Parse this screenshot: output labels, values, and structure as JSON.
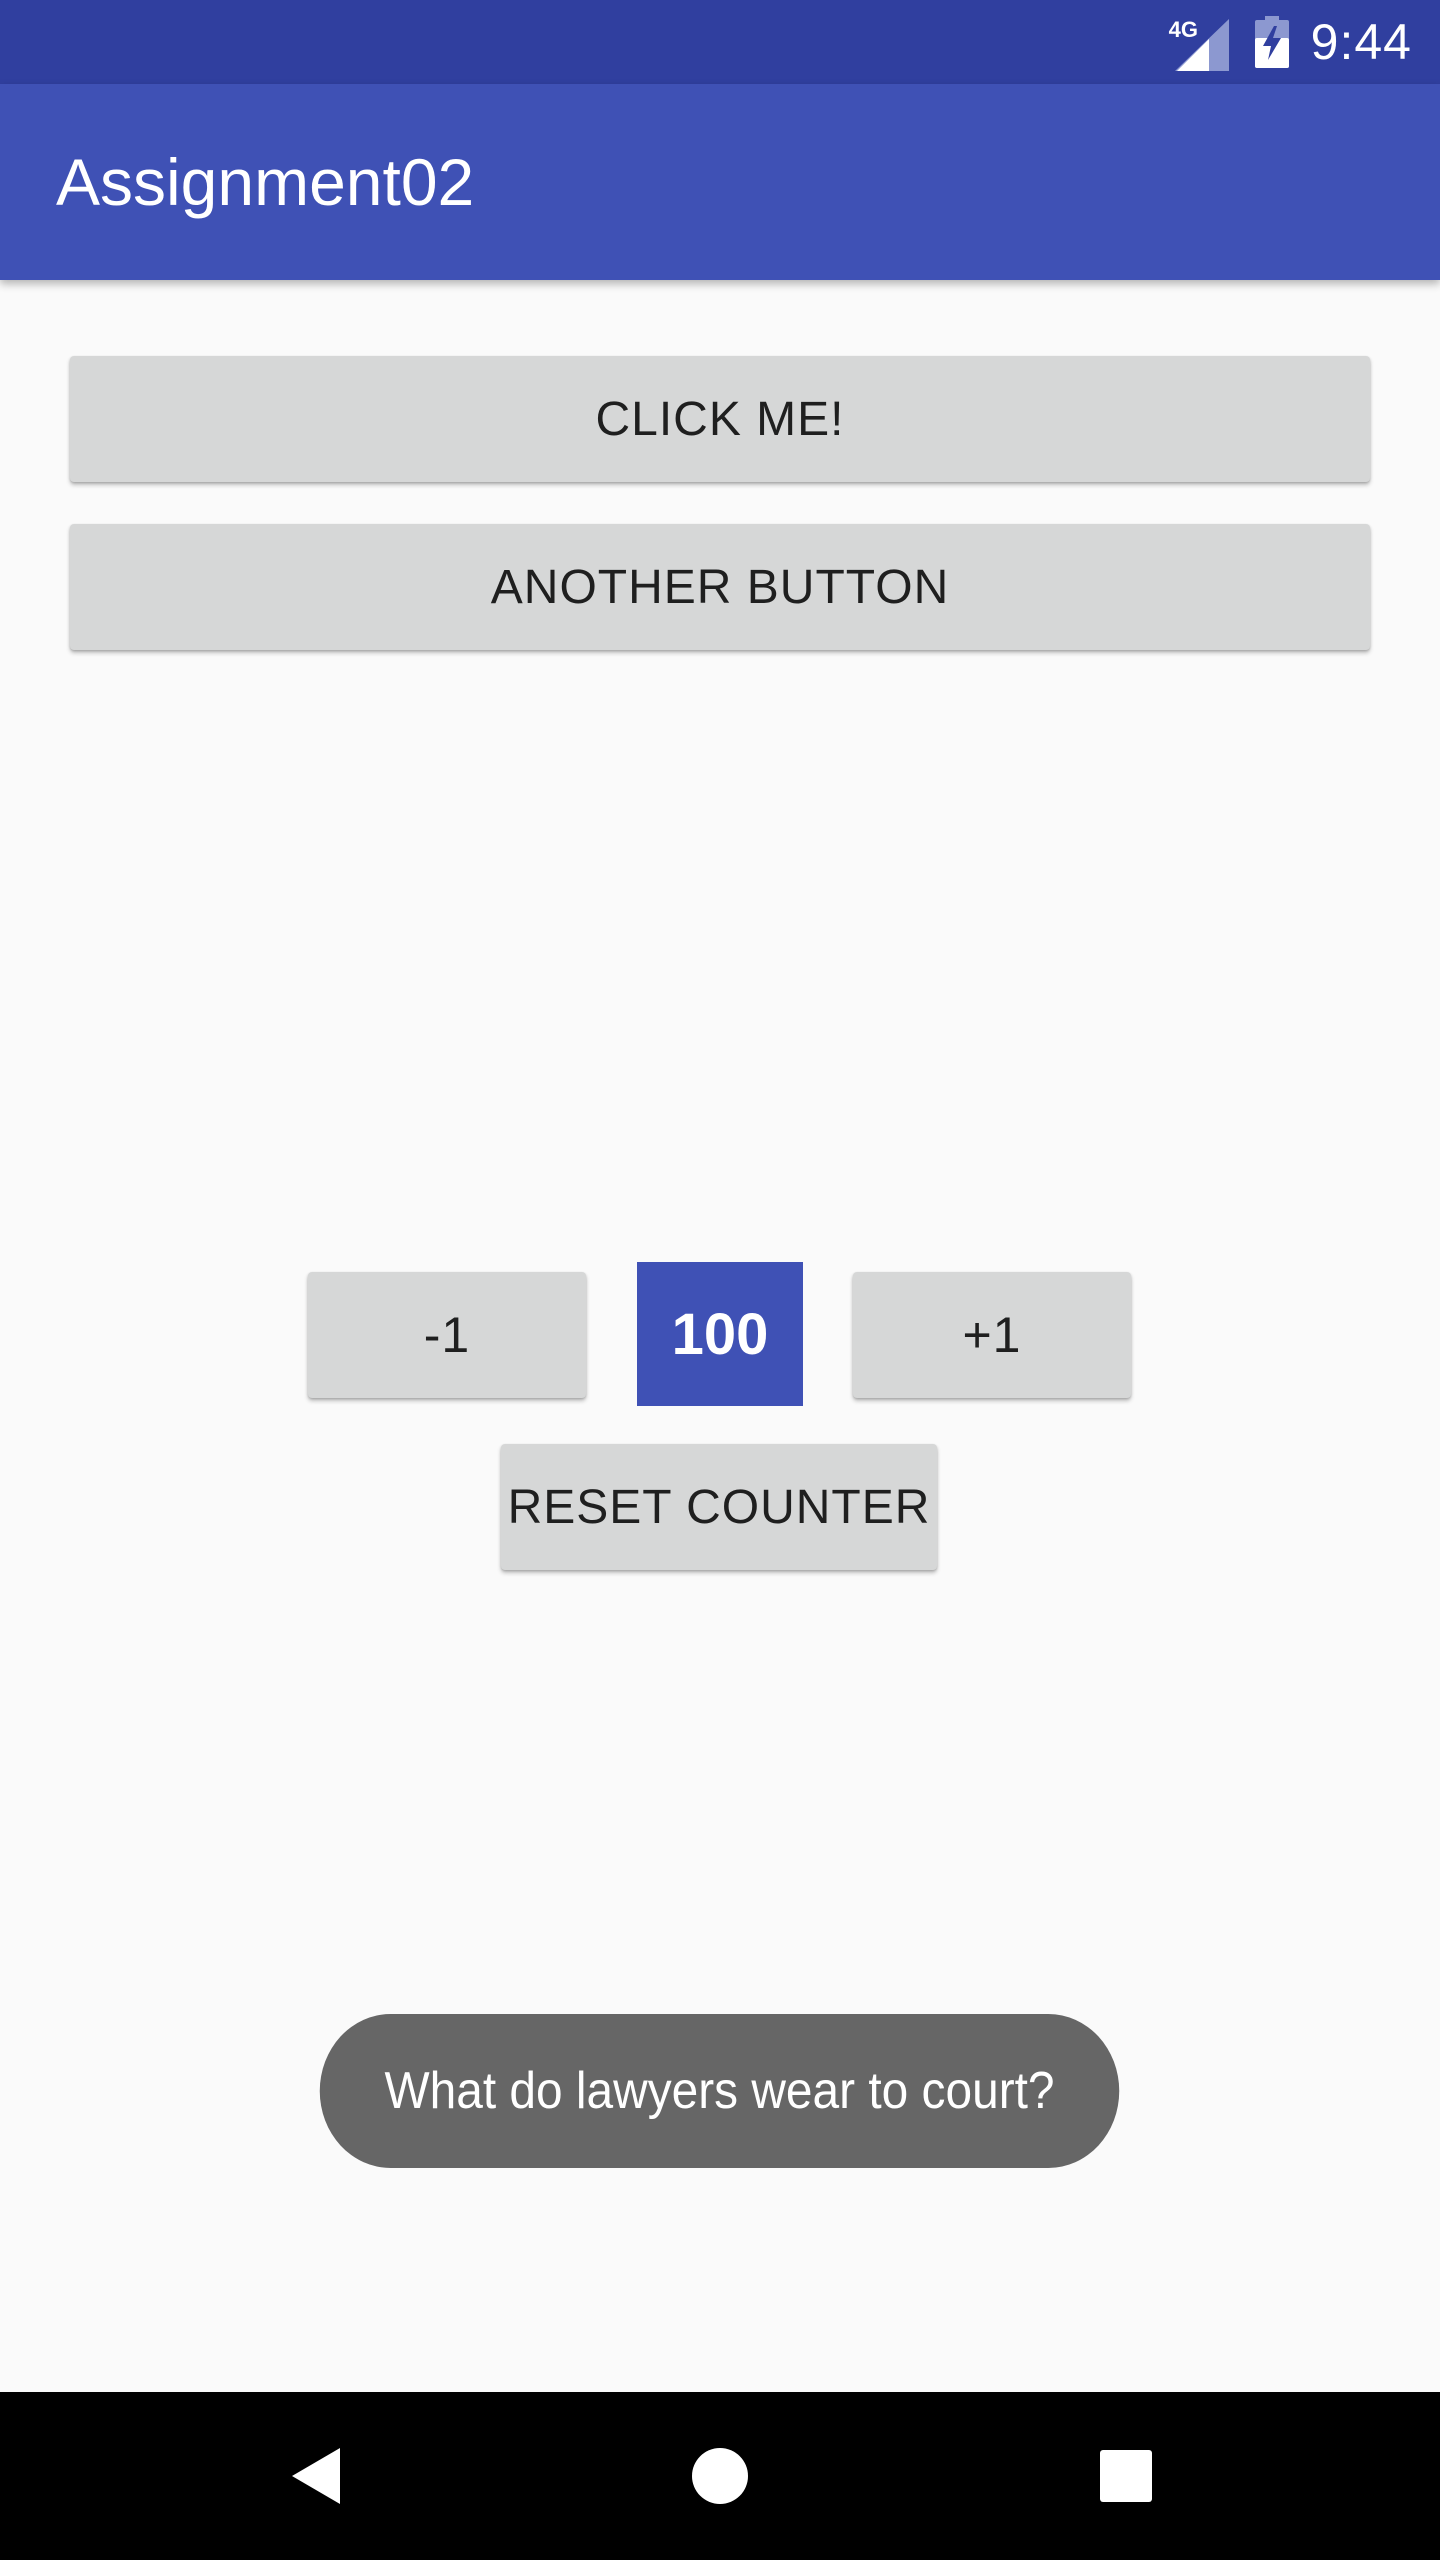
{
  "status_bar": {
    "network_label": "4G",
    "time": "9:44",
    "background_color": "#303f9f"
  },
  "app_bar": {
    "title": "Assignment02",
    "background_color": "#3f51b5"
  },
  "buttons": {
    "click_me": "CLICK ME!",
    "another_button": "ANOTHER BUTTON",
    "minus": "-1",
    "plus": "+1",
    "reset": "RESET COUNTER"
  },
  "counter": {
    "value": "100",
    "background_color": "#3f51b5"
  },
  "toast": {
    "message": "What do lawyers wear to court?"
  },
  "nav_bar": {
    "icons": [
      "back-icon",
      "home-icon",
      "recents-icon"
    ]
  }
}
